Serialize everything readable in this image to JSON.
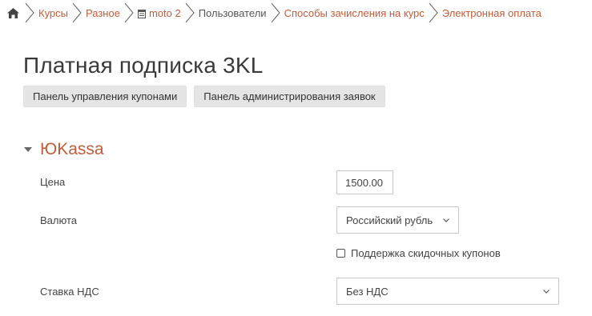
{
  "breadcrumb": {
    "items": [
      {
        "label": "Курсы"
      },
      {
        "label": "Разное"
      },
      {
        "label": "moto 2"
      },
      {
        "label": "Пользователи"
      },
      {
        "label": "Способы зачисления на курс"
      },
      {
        "label": "Электронная оплата"
      }
    ]
  },
  "page": {
    "title": "Платная подписка 3KL"
  },
  "buttons": {
    "coupons": "Панель управления купонами",
    "requests": "Панель администрирования заявок"
  },
  "section": {
    "title": "ЮKassa"
  },
  "form": {
    "price_label": "Цена",
    "price_value": "1500.00",
    "currency_label": "Валюта",
    "currency_value": "Российский рубль",
    "coupon_checkbox_label": "Поддержка скидочных купонов",
    "coupon_checked": false,
    "vat_label": "Ставка НДС",
    "vat_value": "Без НДС"
  },
  "colors": {
    "accent": "#c15d3b",
    "text": "#333333",
    "button_bg": "#e5e5e5",
    "border": "#c8c8c8"
  },
  "icons": {
    "home": "home-icon",
    "separator": "chevron-right-icon",
    "course": "course-icon",
    "collapse": "caret-down-icon",
    "select": "chevron-down-icon"
  }
}
